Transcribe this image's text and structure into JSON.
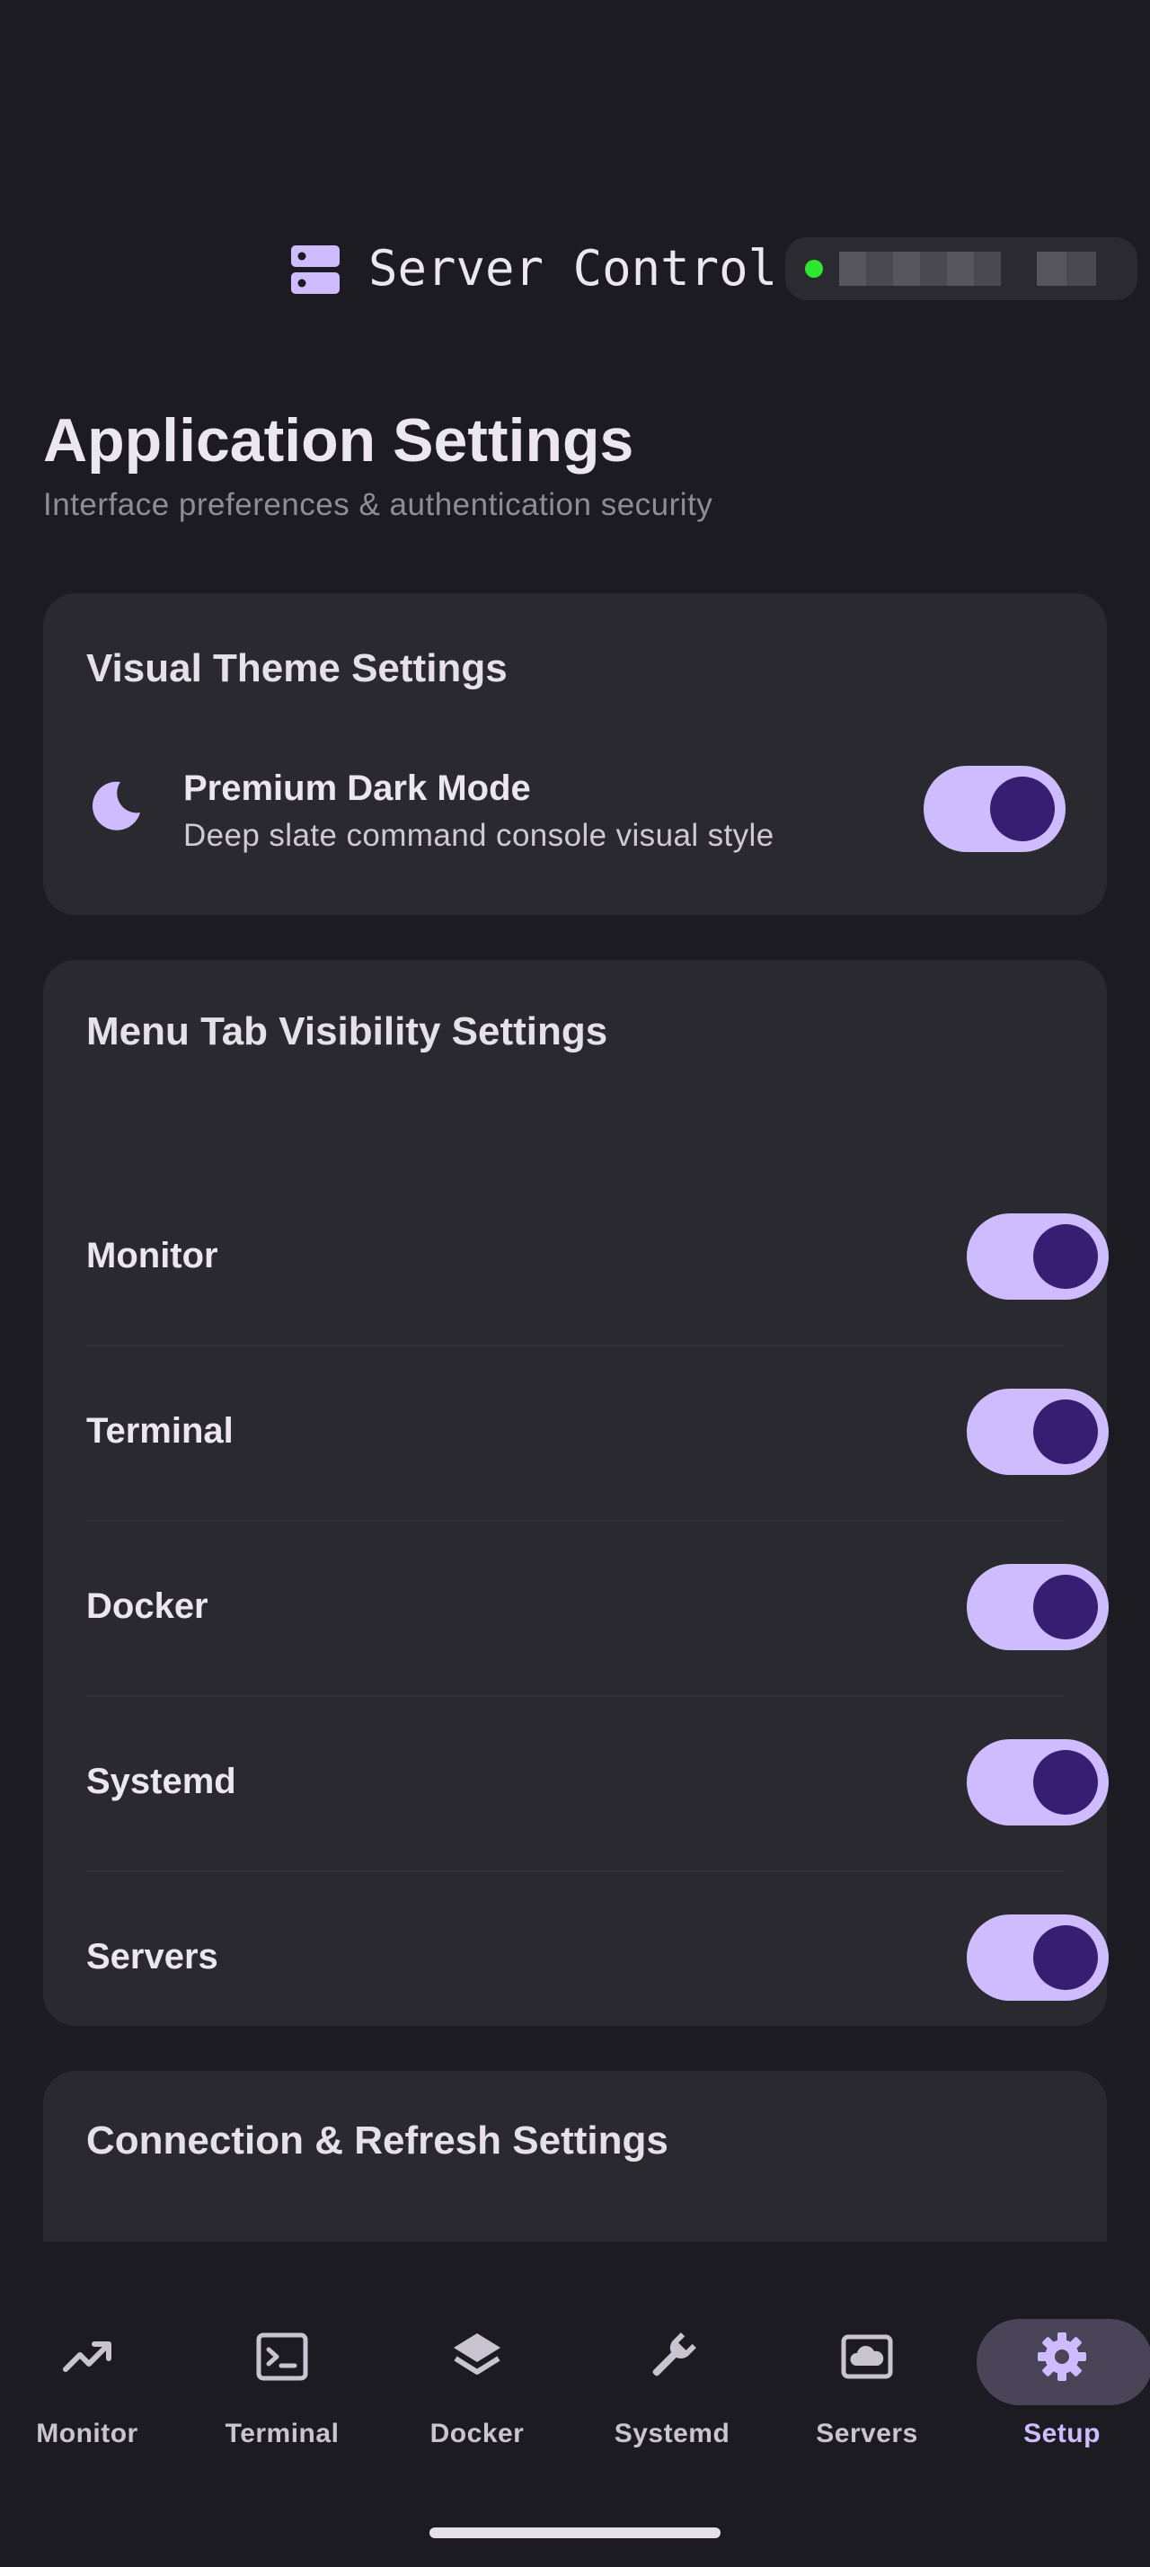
{
  "app": {
    "title": "Server Control",
    "brand_icon": "server-icon",
    "status": {
      "indicator_color": "#2ee82e",
      "label": "",
      "redacted": true
    }
  },
  "page": {
    "title": "Application Settings",
    "subtitle": "Interface preferences & authentication security"
  },
  "theme_card": {
    "title": "Visual Theme Settings",
    "option": {
      "icon": "moon-icon",
      "label": "Premium Dark Mode",
      "description": "Deep slate command console visual style",
      "enabled": true
    }
  },
  "tabs_card": {
    "title": "Menu Tab Visibility Settings",
    "items": [
      {
        "label": "Monitor",
        "enabled": true
      },
      {
        "label": "Terminal",
        "enabled": true
      },
      {
        "label": "Docker",
        "enabled": true
      },
      {
        "label": "Systemd",
        "enabled": true
      },
      {
        "label": "Servers",
        "enabled": true
      }
    ]
  },
  "connection_card": {
    "title": "Connection & Refresh Settings"
  },
  "bottom_nav": {
    "active": "Setup",
    "items": [
      {
        "label": "Monitor",
        "icon": "trending-up-icon"
      },
      {
        "label": "Terminal",
        "icon": "terminal-icon"
      },
      {
        "label": "Docker",
        "icon": "layers-icon"
      },
      {
        "label": "Systemd",
        "icon": "wrench-icon"
      },
      {
        "label": "Servers",
        "icon": "cloud-screen-icon"
      },
      {
        "label": "Setup",
        "icon": "gear-icon"
      }
    ]
  },
  "colors": {
    "background": "#1c1b21",
    "card": "#2a2930",
    "accent": "#cfbcff",
    "toggle_knob": "#381e72",
    "active_nav_pill": "#4a4458"
  }
}
